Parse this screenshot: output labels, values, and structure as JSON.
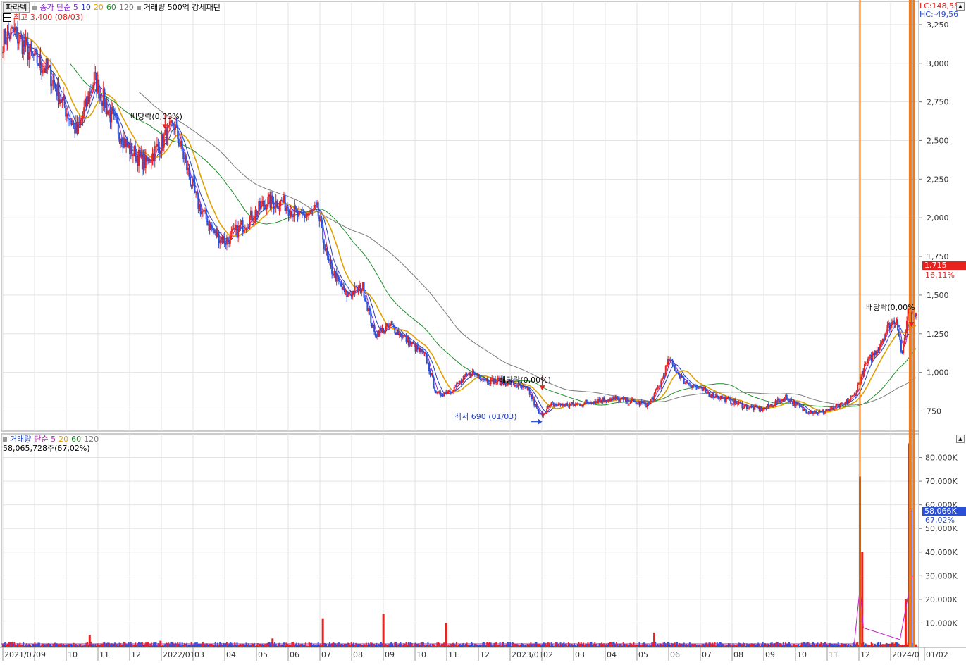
{
  "header": {
    "stock_tab": "파라텍",
    "price_legend": [
      "종가 단순 5",
      "10",
      "20",
      "60",
      "120"
    ],
    "pattern_label": "거래량 500억 강세패턴",
    "high_note": "최고 3,400 (08/03)",
    "lc_label": "LC:148,55",
    "hc_label": "HC:-49,56"
  },
  "volume_header": {
    "title": "거래량",
    "legend": [
      "단순 5",
      "20",
      "60",
      "120"
    ],
    "current": "58,065,728주(67,02%)"
  },
  "annotations": {
    "dividend_1": "배당락(0,00%)",
    "dividend_2": "배당락(0,00%)",
    "dividend_3": "배당락(0,00%",
    "low_note": "최저 690 (01/03)"
  },
  "last_price": {
    "value_label": "1,715",
    "change_label": "16,11%"
  },
  "last_volume": {
    "value_label": "58,066K",
    "ratio_label": "67,02%"
  },
  "colors": {
    "up": "#e8231f",
    "down": "#2b50d8",
    "ma5": "#8b2bd9",
    "ma10": "#1f3fbf",
    "ma20": "#e0a000",
    "ma60": "#1f8c2b",
    "ma120": "#7a7a7a",
    "vma5": "#c21fc2",
    "orange_marker": "#f27a1a"
  },
  "chart_data": [
    {
      "type": "candlestick",
      "title": "",
      "ylim": [
        620,
        3400
      ],
      "y_ticks": [
        "750",
        "1,000",
        "1,250",
        "1,500",
        "1,750",
        "2,000",
        "2,250",
        "2,500",
        "2,750",
        "3,000",
        "3,250"
      ],
      "y_tick_values": [
        750,
        1000,
        1250,
        1500,
        1750,
        2000,
        2250,
        2500,
        2750,
        3000,
        3250
      ],
      "x_labels": [
        "2021/07",
        "09",
        "10",
        "11",
        "12",
        "2022/01",
        "03",
        "04",
        "05",
        "06",
        "07",
        "08",
        "09",
        "10",
        "11",
        "12",
        "2023/01",
        "02",
        "03",
        "04",
        "05",
        "06",
        "07",
        "08",
        "09",
        "10",
        "11",
        "12",
        "2024/0",
        "01/02"
      ],
      "anchor_prices": [
        [
          0,
          3150
        ],
        [
          10,
          3200
        ],
        [
          25,
          3050
        ],
        [
          40,
          2950
        ],
        [
          55,
          2700
        ],
        [
          65,
          2550
        ],
        [
          80,
          2900
        ],
        [
          95,
          2650
        ],
        [
          110,
          2450
        ],
        [
          125,
          2350
        ],
        [
          140,
          2500
        ],
        [
          150,
          2600
        ],
        [
          160,
          2350
        ],
        [
          170,
          2100
        ],
        [
          185,
          1900
        ],
        [
          195,
          1850
        ],
        [
          210,
          1950
        ],
        [
          230,
          2100
        ],
        [
          245,
          2100
        ],
        [
          260,
          2000
        ],
        [
          275,
          2050
        ],
        [
          285,
          1700
        ],
        [
          300,
          1500
        ],
        [
          315,
          1550
        ],
        [
          325,
          1250
        ],
        [
          340,
          1300
        ],
        [
          355,
          1200
        ],
        [
          370,
          1100
        ],
        [
          380,
          850
        ],
        [
          395,
          900
        ],
        [
          410,
          1000
        ],
        [
          425,
          950
        ],
        [
          445,
          930
        ],
        [
          460,
          880
        ],
        [
          470,
          720
        ],
        [
          480,
          790
        ],
        [
          500,
          790
        ],
        [
          520,
          820
        ],
        [
          535,
          830
        ],
        [
          550,
          810
        ],
        [
          565,
          790
        ],
        [
          575,
          920
        ],
        [
          583,
          1080
        ],
        [
          595,
          950
        ],
        [
          615,
          870
        ],
        [
          635,
          820
        ],
        [
          650,
          780
        ],
        [
          665,
          760
        ],
        [
          685,
          840
        ],
        [
          700,
          760
        ],
        [
          715,
          740
        ],
        [
          735,
          790
        ],
        [
          745,
          850
        ],
        [
          755,
          1050
        ],
        [
          765,
          1150
        ],
        [
          775,
          1300
        ],
        [
          782,
          1350
        ],
        [
          787,
          1100
        ],
        [
          792,
          1400
        ]
      ],
      "moving_averages": [
        "5",
        "10",
        "20",
        "60",
        "120"
      ],
      "dividend_marker_values": [
        2560,
        870,
        1280
      ],
      "low_value": 690,
      "high_value": 3400
    },
    {
      "type": "bar",
      "title": "",
      "ylim": [
        0,
        90000
      ],
      "y_ticks": [
        "10,000K",
        "20,000K",
        "30,000K",
        "40,000K",
        "50,000K",
        "60,000K",
        "70,000K",
        "80,000K"
      ],
      "y_tick_values": [
        10000,
        20000,
        30000,
        40000,
        50000,
        60000,
        70000,
        80000
      ],
      "spikes_k": [
        [
          76,
          5000
        ],
        [
          138,
          2500
        ],
        [
          236,
          3500
        ],
        [
          280,
          12000
        ],
        [
          333,
          14000
        ],
        [
          388,
          10000
        ],
        [
          424,
          2000
        ],
        [
          570,
          6000
        ],
        [
          750,
          72000
        ],
        [
          752,
          40000
        ],
        [
          790,
          20000
        ],
        [
          793,
          86000
        ],
        [
          795,
          58066
        ]
      ]
    }
  ]
}
